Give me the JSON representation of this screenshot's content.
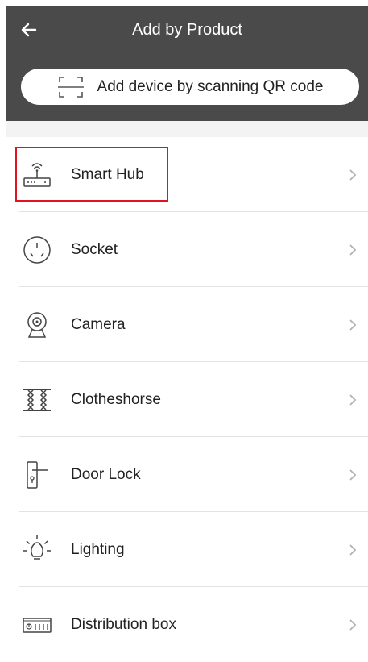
{
  "header": {
    "title": "Add by Product",
    "back_icon": "arrow-left-icon"
  },
  "scan": {
    "label": "Add device by scanning QR code",
    "icon": "qr-scan-icon"
  },
  "products": [
    {
      "label": "Smart Hub",
      "icon": "router-icon"
    },
    {
      "label": "Socket",
      "icon": "socket-icon"
    },
    {
      "label": "Camera",
      "icon": "camera-icon"
    },
    {
      "label": "Clotheshorse",
      "icon": "clotheshorse-icon"
    },
    {
      "label": "Door Lock",
      "icon": "door-lock-icon"
    },
    {
      "label": "Lighting",
      "icon": "bulb-icon"
    },
    {
      "label": "Distribution box",
      "icon": "distribution-box-icon"
    }
  ],
  "colors": {
    "header_bg": "#4a4a4a",
    "highlight_border": "#e0141e",
    "divider": "#e3e3e3",
    "chevron": "#b0b0b0"
  }
}
